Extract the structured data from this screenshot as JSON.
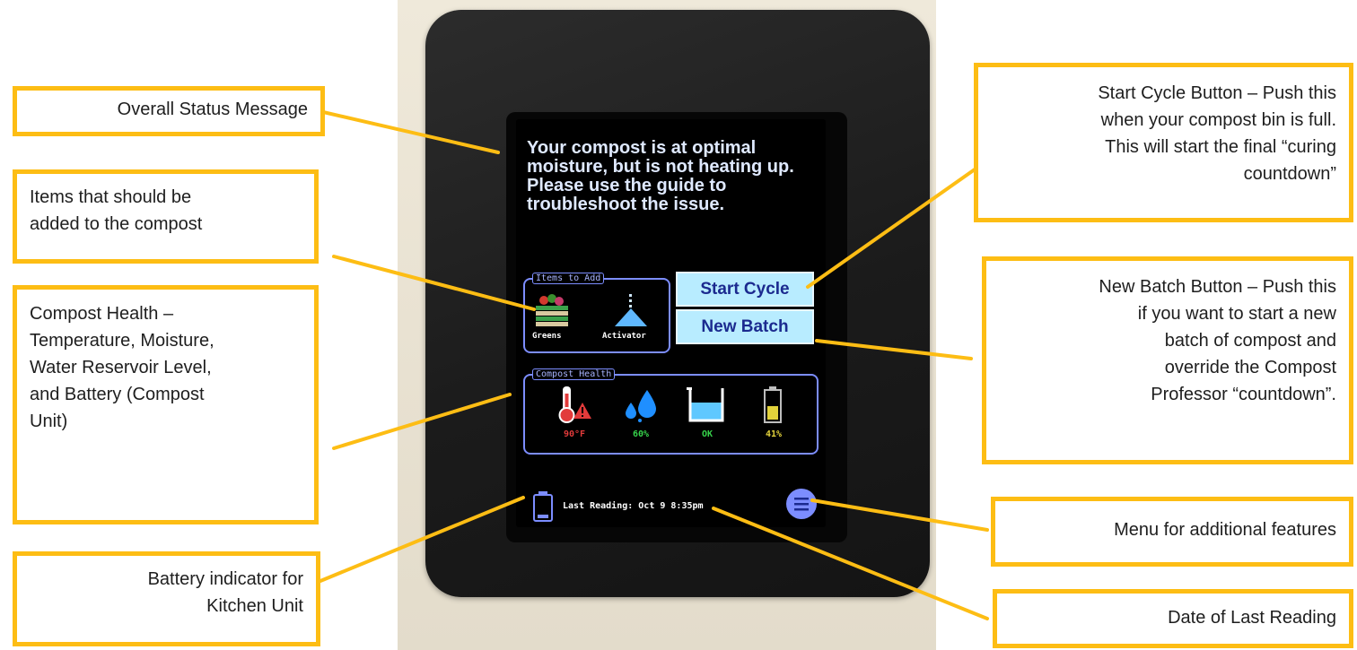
{
  "device_screen": {
    "status_message": "Your compost is at optimal moisture, but is not heating up. Please use the guide to troubleshoot the issue.",
    "items_to_add": {
      "title": "Items to Add",
      "items": [
        {
          "label": "Greens",
          "icon": "greens-crate-icon"
        },
        {
          "label": "Activator",
          "icon": "activator-pile-icon"
        }
      ]
    },
    "buttons": {
      "start_cycle": "Start Cycle",
      "new_batch": "New Batch"
    },
    "compost_health": {
      "title": "Compost Health",
      "metrics": [
        {
          "name": "temperature",
          "value": "90°F",
          "color": "#e23b3b",
          "icon": "thermometer-warning-icon"
        },
        {
          "name": "moisture",
          "value": "60%",
          "color": "#36d24b",
          "icon": "water-drops-icon"
        },
        {
          "name": "water_reservoir",
          "value": "OK",
          "color": "#36d24b",
          "icon": "water-beaker-icon"
        },
        {
          "name": "battery",
          "value": "41%",
          "color": "#e2d23b",
          "icon": "battery-icon"
        }
      ]
    },
    "footer": {
      "last_reading": "Last Reading: Oct 9 8:35pm",
      "battery_icon": "kitchen-battery-icon",
      "menu_icon": "menu-icon"
    }
  },
  "callouts": {
    "overall_status": "Overall Status Message",
    "items_to_add": [
      "Items that should be",
      "added to the compost"
    ],
    "compost_health": [
      "Compost Health –",
      "Temperature, Moisture,",
      "Water Reservoir Level,",
      "and Battery (Compost",
      "Unit)"
    ],
    "battery_indicator": [
      "Battery indicator for",
      "Kitchen Unit"
    ],
    "start_cycle": [
      "Start Cycle Button – Push this",
      "when your compost bin is full.",
      "This will start the final “curing",
      "countdown”"
    ],
    "new_batch": [
      "New Batch Button – Push this",
      "if you want to start a new",
      "batch of compost and",
      "override the Compost",
      "Professor “countdown”."
    ],
    "menu": "Menu for additional features",
    "last_reading": "Date of Last Reading"
  },
  "colors": {
    "callout_border": "#fdbd14",
    "screen_accent": "#7c8dff",
    "button_fill": "#b8ecff"
  }
}
